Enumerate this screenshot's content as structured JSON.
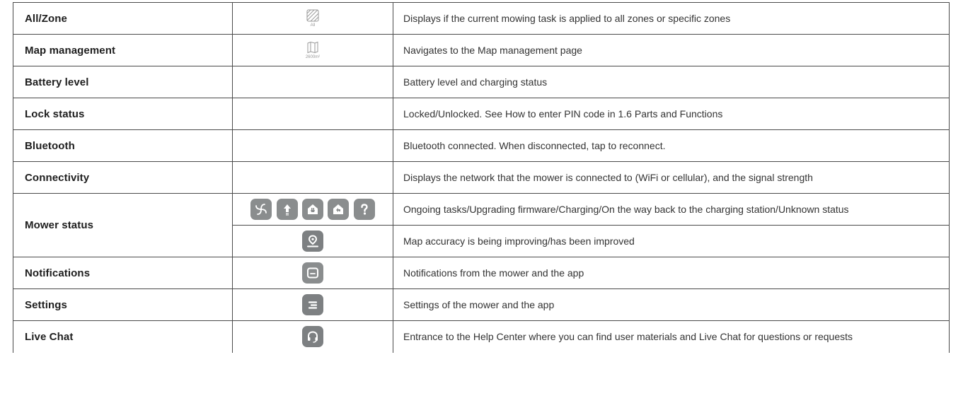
{
  "rows": [
    {
      "name": "All/Zone",
      "icon_caption": "All",
      "desc": "Displays if the current mowing task is applied to all zones or specific zones"
    },
    {
      "name": "Map management",
      "icon_caption": "2600m²",
      "desc": "Navigates to the Map management page"
    },
    {
      "name": "Battery level",
      "desc": "Battery level and charging status"
    },
    {
      "name": "Lock status",
      "desc": "Locked/Unlocked. See How to enter PIN code in 1.6 Parts and Functions"
    },
    {
      "name": "Bluetooth",
      "desc": "Bluetooth connected. When disconnected, tap to reconnect."
    },
    {
      "name": "Connectivity",
      "desc": "Displays the network that the mower is connected to (WiFi or cellular), and the signal strength"
    },
    {
      "name": "Mower status",
      "desc": "Ongoing tasks/Upgrading firmware/Charging/On the way back to the charging station/Unknown status",
      "desc2": "Map accuracy is being improving/has been improved"
    },
    {
      "name": "Notifications",
      "desc": "Notifications from the mower and the app"
    },
    {
      "name": "Settings",
      "desc": "Settings of the mower and the app"
    },
    {
      "name": "Live Chat",
      "desc": "Entrance to the Help Center where you can find user materials and Live Chat for questions or requests"
    }
  ],
  "icons": {
    "all_zone": "hatched-square-icon",
    "map": "folded-map-icon",
    "mower_status": [
      "pinwheel-icon",
      "upload-arrow-icon",
      "charging-plug-icon",
      "return-arrow-icon",
      "question-mark-icon"
    ],
    "map_accuracy": "map-pin-icon",
    "notifications": "message-icon",
    "settings": "menu-lines-icon",
    "live_chat": "headset-icon"
  },
  "colors": {
    "border": "#4a4a4a",
    "icon_fill": "#8a8d8e"
  }
}
